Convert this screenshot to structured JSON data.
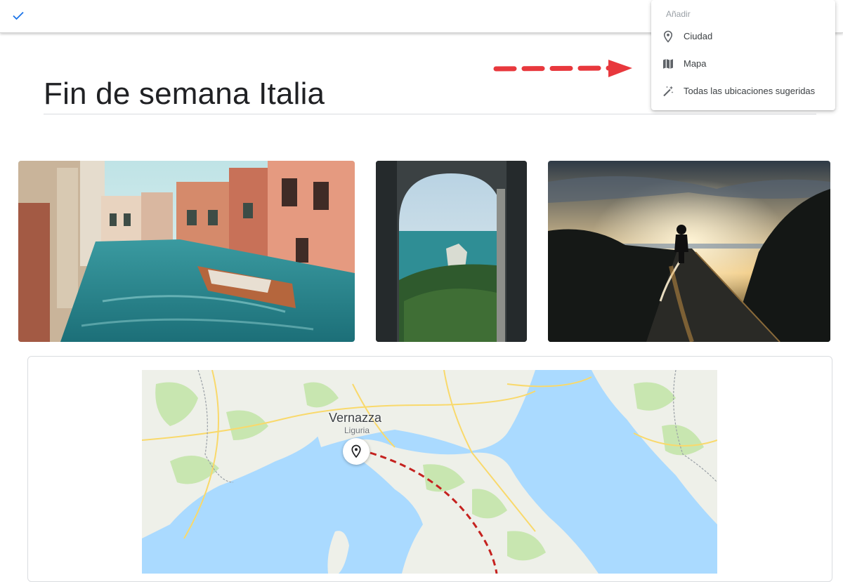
{
  "trip": {
    "title": "Fin de semana Italia"
  },
  "add_menu": {
    "heading": "Añadir",
    "items": [
      {
        "label": "Ciudad",
        "icon": "location-pin-icon"
      },
      {
        "label": "Mapa",
        "icon": "map-icon"
      },
      {
        "label": "Todas las ubicaciones sugeridas",
        "icon": "magic-wand-icon"
      }
    ]
  },
  "map": {
    "city": "Vernazza",
    "region": "Liguria"
  },
  "colors": {
    "accent": "#1a73e8",
    "annotation_arrow": "#e8383d",
    "sea": "#aadaff",
    "land": "#f1f3f4",
    "park": "#c8e6b0",
    "road": "#f9d96b"
  }
}
